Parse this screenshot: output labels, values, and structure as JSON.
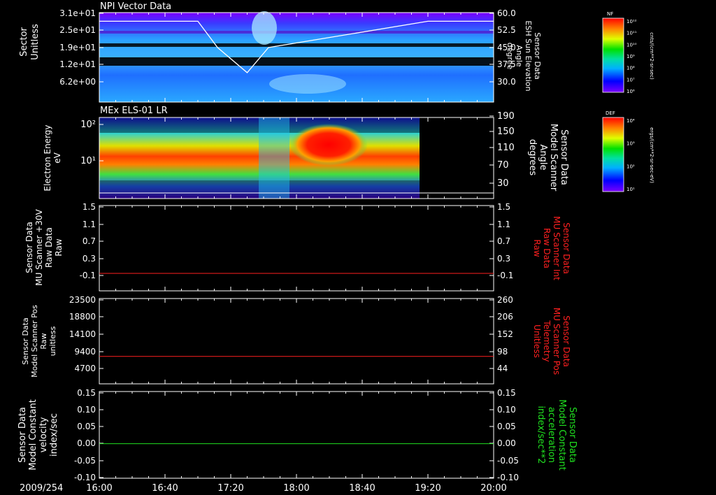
{
  "chart_data": [
    {
      "type": "heatmap",
      "title": "NPI Vector Data",
      "ylabel_left": [
        "Sector",
        "Unitless"
      ],
      "yticks_left": [
        "3.1e+01",
        "2.5e+01",
        "1.9e+01",
        "1.2e+01",
        "6.2e+00"
      ],
      "ylabel_right": [
        "Sensor Data",
        "ESH Sun Elevation",
        "Angle",
        "degree"
      ],
      "yticks_right": [
        "60.0",
        "52.5",
        "45.0",
        "37.5",
        "30.0"
      ],
      "overlay_series": {
        "name": "Sensor Data ESH Sun Elevation Angle",
        "x": [
          "16:00",
          "17:00",
          "17:12",
          "17:30",
          "17:43",
          "19:20",
          "20:00"
        ],
        "y": [
          56.5,
          56.5,
          45,
          34,
          45,
          56.5,
          56.5
        ]
      },
      "colorbar": {
        "label": "NF",
        "ticks": [
          "10¹²",
          "10¹¹",
          "10¹⁰",
          "10⁹",
          "10⁸",
          "10⁷",
          "10⁶"
        ],
        "unit": "cnts/(cm**2-sr-sec)"
      }
    },
    {
      "type": "heatmap",
      "title": "MEx ELS-01 LR",
      "ylabel_left": [
        "Electron Energy",
        "eV"
      ],
      "yticks_left": [
        "10²",
        "10¹"
      ],
      "ylabel_right": [
        "Sensor Data",
        "Model Scanner",
        "Angle",
        "degrees"
      ],
      "yticks_right": [
        "190",
        "150",
        "110",
        "70",
        "30"
      ],
      "colorbar": {
        "label": "DEF",
        "ticks": [
          "10⁴",
          "10³",
          "10²",
          "10¹"
        ],
        "unit": "ergs/(cm**2-sr-sec-eV)"
      }
    },
    {
      "type": "line",
      "ylabel_left": [
        "Sensor Data",
        "MU Scanner +30V",
        "Raw Data",
        "Raw"
      ],
      "yticks_left": [
        "1.5",
        "1.1",
        "0.7",
        "0.3",
        "-0.1"
      ],
      "ylabel_right": [
        "Sensor Data",
        "MU Scanner Int",
        "Raw Data",
        "Raw"
      ],
      "yticks_right": [
        "1.5",
        "1.1",
        "0.7",
        "0.3",
        "-0.1"
      ],
      "ylim": [
        -0.3,
        1.5
      ],
      "series": [
        {
          "name": "Sensor Data MU Scanner Int Raw Data",
          "color": "#ff2020",
          "x": [
            "16:00",
            "20:00"
          ],
          "y": [
            -0.05,
            -0.05
          ]
        }
      ]
    },
    {
      "type": "line",
      "ylabel_left": [
        "Sensor Data",
        "Model Scanner Pos",
        "Raw",
        "unitless"
      ],
      "yticks_left": [
        "23500",
        "18800",
        "14100",
        "9400",
        "4700"
      ],
      "ylabel_right": [
        "Sensor Data",
        "MU Scanner Pos",
        "Telemetry",
        "Unitless"
      ],
      "yticks_right": [
        "260",
        "206",
        "152",
        "98",
        "44"
      ],
      "ylim": [
        0,
        23500
      ],
      "series": [
        {
          "name": "Sensor Data MU Scanner Pos Telemetry",
          "color": "#ff2020",
          "x": [
            "16:00",
            "20:00"
          ],
          "y": [
            8000,
            8000
          ]
        }
      ]
    },
    {
      "type": "line",
      "ylabel_left": [
        "Sensor Data",
        "Model Constant",
        "velocity",
        "index/sec"
      ],
      "yticks_left": [
        "0.15",
        "0.10",
        "0.05",
        "0.00",
        "-0.05",
        "-0.10"
      ],
      "ylabel_right": [
        "Sensor Data",
        "Model Constant",
        "acceleration",
        "index/sec**2"
      ],
      "yticks_right": [
        "0.15",
        "0.10",
        "0.05",
        "0.00",
        "-0.05",
        "-0.10"
      ],
      "ylim": [
        -0.1,
        0.15
      ],
      "series": [
        {
          "name": "Sensor Data Model Constant acceleration",
          "color": "#20e020",
          "x": [
            "16:00",
            "20:00"
          ],
          "y": [
            0.0,
            0.0
          ]
        }
      ]
    }
  ],
  "time_axis": {
    "date": "2009/254",
    "ticks": [
      "16:00",
      "16:40",
      "17:20",
      "18:00",
      "18:40",
      "19:20",
      "20:00"
    ]
  },
  "colors": {
    "right_label_panel3": "#ff2020",
    "right_label_panel4": "#ff2020",
    "right_label_panel5": "#20e020"
  }
}
